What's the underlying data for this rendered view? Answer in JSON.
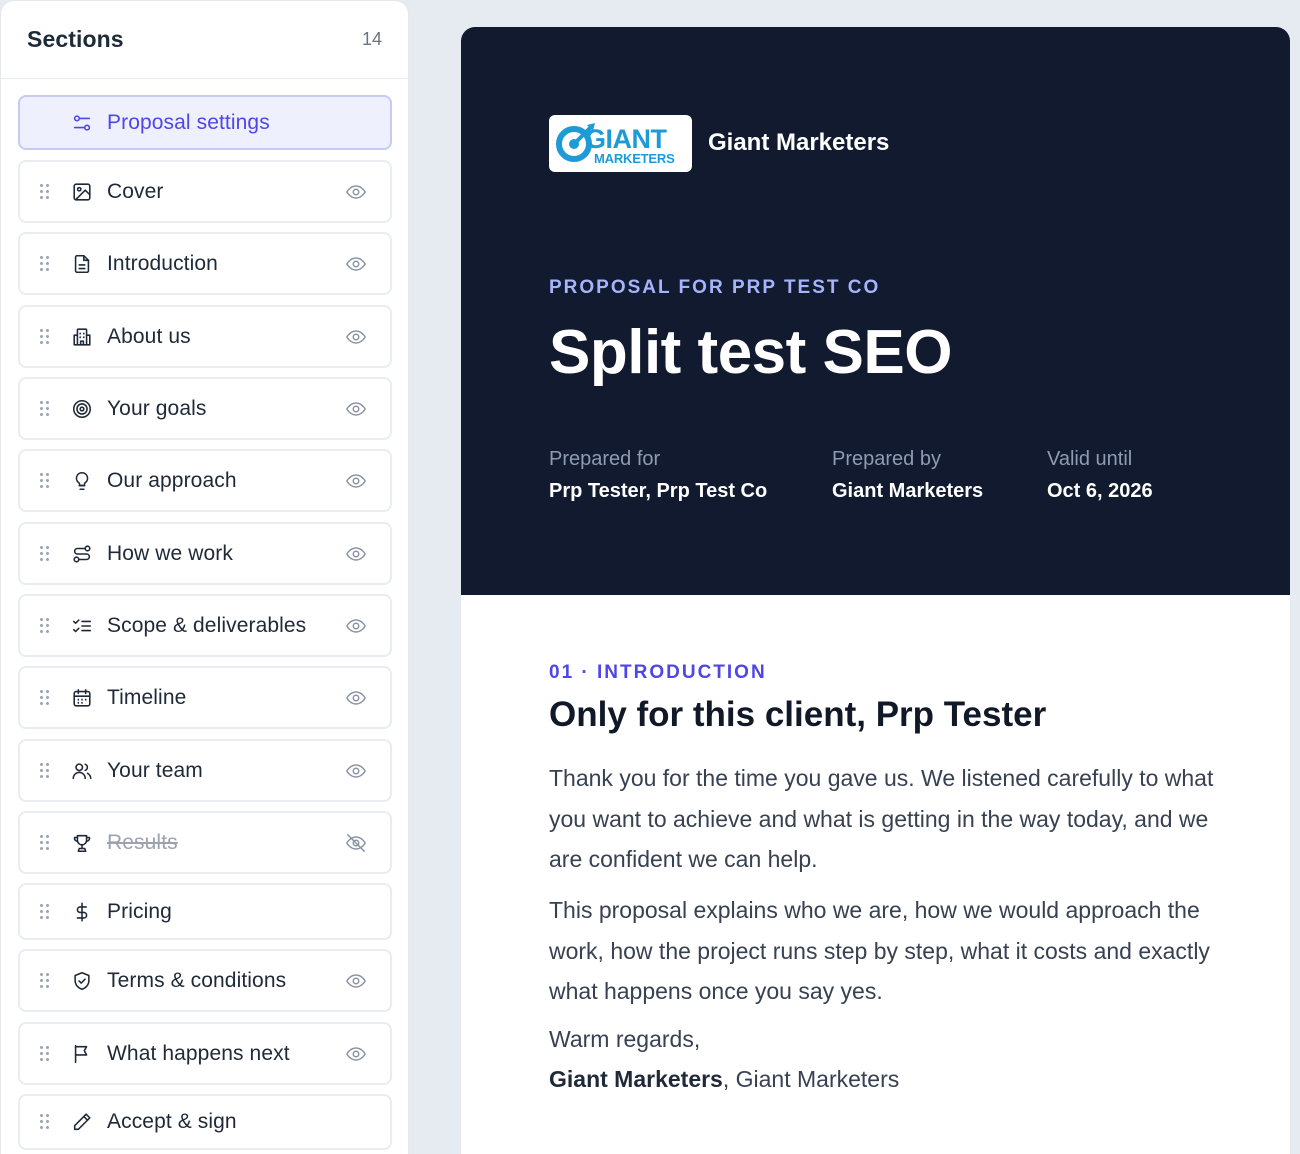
{
  "sidebar": {
    "title": "Sections",
    "count": "14",
    "active_item": {
      "label": "Proposal settings",
      "icon": "sliders-icon"
    },
    "items": [
      {
        "label": "Cover",
        "icon": "image-icon",
        "visibility_icon": "eye-icon",
        "hidden": false
      },
      {
        "label": "Introduction",
        "icon": "document-icon",
        "visibility_icon": "eye-icon",
        "hidden": false
      },
      {
        "label": "About us",
        "icon": "building-icon",
        "visibility_icon": "eye-icon",
        "hidden": false
      },
      {
        "label": "Your goals",
        "icon": "target-icon",
        "visibility_icon": "eye-icon",
        "hidden": false
      },
      {
        "label": "Our approach",
        "icon": "lightbulb-icon",
        "visibility_icon": "eye-icon",
        "hidden": false
      },
      {
        "label": "How we work",
        "icon": "route-icon",
        "visibility_icon": "eye-icon",
        "hidden": false
      },
      {
        "label": "Scope & deliverables",
        "icon": "checklist-icon",
        "visibility_icon": "eye-icon",
        "hidden": false
      },
      {
        "label": "Timeline",
        "icon": "calendar-icon",
        "visibility_icon": "eye-icon",
        "hidden": false
      },
      {
        "label": "Your team",
        "icon": "users-icon",
        "visibility_icon": "eye-icon",
        "hidden": false
      },
      {
        "label": "Results",
        "icon": "trophy-icon",
        "visibility_icon": "eye-off-icon",
        "hidden": true
      },
      {
        "label": "Pricing",
        "icon": "dollar-icon",
        "visibility_icon": "",
        "hidden": false
      },
      {
        "label": "Terms & conditions",
        "icon": "shield-icon",
        "visibility_icon": "eye-icon",
        "hidden": false
      },
      {
        "label": "What happens next",
        "icon": "flag-icon",
        "visibility_icon": "eye-icon",
        "hidden": false
      },
      {
        "label": "Accept & sign",
        "icon": "pen-icon",
        "visibility_icon": "",
        "hidden": false
      }
    ]
  },
  "hero": {
    "logo_text_top": "GIANT",
    "logo_text_bottom": "MARKETERS",
    "brand_name": "Giant Marketers",
    "eyebrow": "PROPOSAL FOR PRP TEST CO",
    "title": "Split test SEO",
    "meta": [
      {
        "label": "Prepared for",
        "value": "Prp Tester, Prp Test Co"
      },
      {
        "label": "Prepared by",
        "value": "Giant Marketers"
      },
      {
        "label": "Valid until",
        "value": "Oct 6, 2026"
      }
    ]
  },
  "intro": {
    "eyebrow": "01 · INTRODUCTION",
    "title": "Only for this client, Prp Tester",
    "paragraphs": [
      "Thank you for the time you gave us. We listened carefully to what you want to achieve and what is getting in the way today, and we are confident we can help.",
      "This proposal explains who we are, how we would approach the work, how the project runs step by step, what it costs and exactly what happens once you say yes."
    ],
    "signoff": "Warm regards,",
    "signer_bold": "Giant Marketers",
    "signer_rest": ", Giant Marketers"
  },
  "colors": {
    "accent": "#4f46e5",
    "hero_bg": "#111a2e",
    "eyebrow_light": "#a5b4fc",
    "page_bg": "#e6ebf2",
    "logo_blue": "#1e9bd7"
  }
}
